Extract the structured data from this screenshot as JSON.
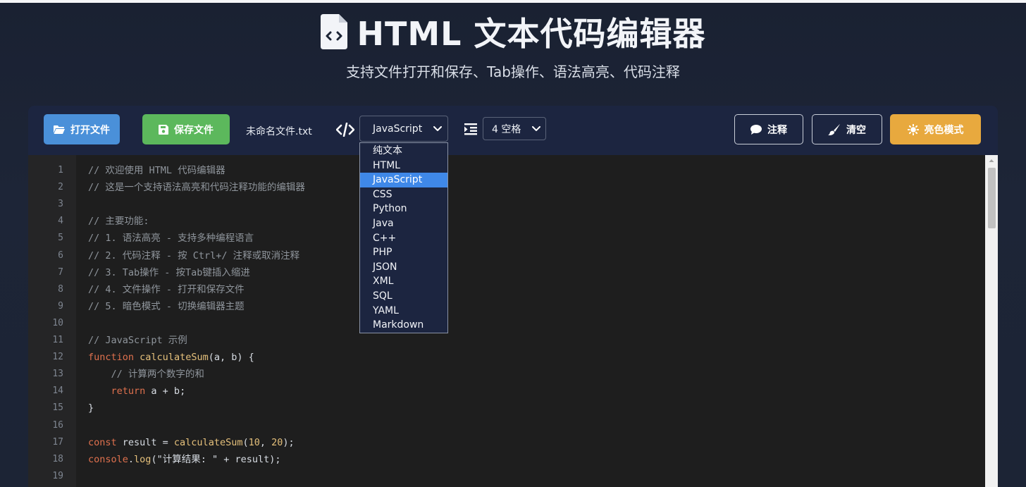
{
  "header": {
    "title": "HTML 文本代码编辑器",
    "subtitle": "支持文件打开和保存、Tab操作、语法高亮、代码注释"
  },
  "toolbar": {
    "open_label": "打开文件",
    "save_label": "保存文件",
    "filename": "未命名文件.txt",
    "language_selected": "JavaScript",
    "indent_selected": "4 空格",
    "comment_label": "注释",
    "clear_label": "清空",
    "theme_label": "亮色模式"
  },
  "language_options": [
    "纯文本",
    "HTML",
    "JavaScript",
    "CSS",
    "Python",
    "Java",
    "C++",
    "PHP",
    "JSON",
    "XML",
    "SQL",
    "YAML",
    "Markdown"
  ],
  "colors": {
    "open_button": "#4a90d9",
    "save_button": "#5cb85c",
    "theme_button": "#e8a93e",
    "selected_option": "#3f88e8",
    "comment_text": "#8f959c",
    "keyword_text": "#e0714e",
    "function_text": "#e5c07b"
  },
  "icons": {
    "title": "file-code-icon",
    "open": "folder-open-icon",
    "save": "save-icon",
    "code": "code-icon",
    "indent": "indent-icon",
    "comment": "comment-icon",
    "clear": "brush-icon",
    "theme": "sun-icon"
  },
  "editor": {
    "line_numbers": [
      "1",
      "2",
      "3",
      "4",
      "5",
      "6",
      "7",
      "8",
      "9",
      "10",
      "11",
      "12",
      "13",
      "14",
      "15",
      "16",
      "17",
      "18",
      "19"
    ],
    "lines": [
      "// 欢迎使用 HTML 代码编辑器",
      "// 这是一个支持语法高亮和代码注释功能的编辑器",
      "",
      "// 主要功能:",
      "// 1. 语法高亮 - 支持多种编程语言",
      "// 2. 代码注释 - 按 Ctrl+/ 注释或取消注释",
      "// 3. Tab操作 - 按Tab键插入缩进",
      "// 4. 文件操作 - 打开和保存文件",
      "// 5. 暗色模式 - 切换编辑器主题",
      "",
      "// JavaScript 示例",
      "function calculateSum(a, b) {",
      "    // 计算两个数字的和",
      "    return a + b;",
      "}",
      "",
      "const result = calculateSum(10, 20);",
      "console.log(\"计算结果: \" + result);",
      ""
    ]
  }
}
